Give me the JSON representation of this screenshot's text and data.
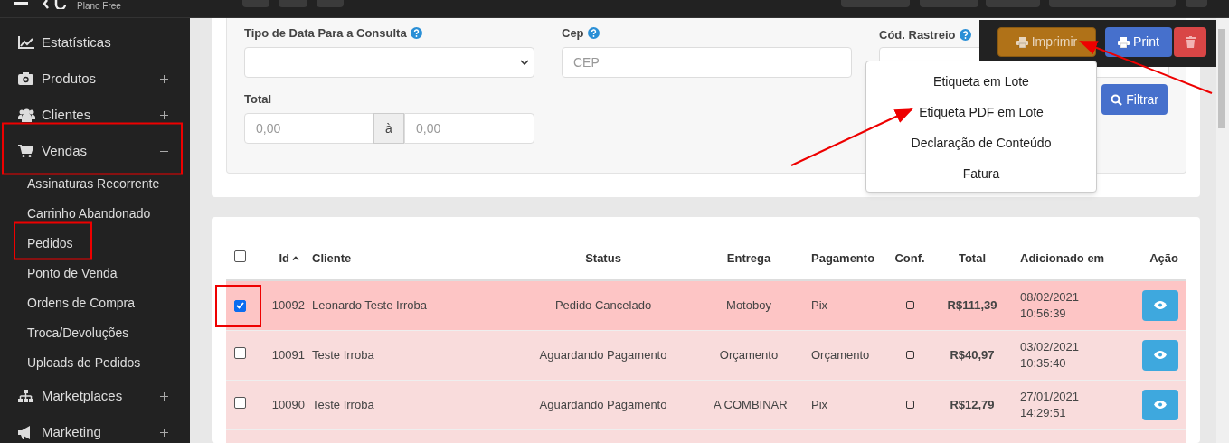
{
  "header": {
    "plan": "Plano Free"
  },
  "sidebar": {
    "items": [
      {
        "label": "Estatísticas",
        "kind": "link"
      },
      {
        "label": "Produtos",
        "kind": "group",
        "expanded": false
      },
      {
        "label": "Clientes",
        "kind": "group",
        "expanded": false
      },
      {
        "label": "Vendas",
        "kind": "group",
        "expanded": true,
        "children": [
          {
            "label": "Assinaturas Recorrente"
          },
          {
            "label": "Carrinho Abandonado"
          },
          {
            "label": "Pedidos"
          },
          {
            "label": "Ponto de Venda"
          },
          {
            "label": "Ordens de Compra"
          },
          {
            "label": "Troca/Devoluções"
          },
          {
            "label": "Uploads de Pedidos"
          }
        ]
      },
      {
        "label": "Marketplaces",
        "kind": "group",
        "expanded": false
      },
      {
        "label": "Marketing",
        "kind": "group",
        "expanded": false
      }
    ]
  },
  "filters": {
    "date_type": {
      "label": "Tipo de Data Para a Consulta"
    },
    "cep": {
      "label": "Cep",
      "placeholder": "CEP"
    },
    "tracking": {
      "label": "Cód. Rastreio"
    },
    "total": {
      "label": "Total",
      "from_placeholder": "0,00",
      "separator": "à",
      "to_placeholder": "0,00"
    },
    "filter_button": "Filtrar"
  },
  "actions": {
    "print_menu": "Imprimir",
    "print": "Print",
    "menu_items": [
      "Etiqueta em Lote",
      "Etiqueta PDF em Lote",
      "Declaração de Conteúdo",
      "Fatura"
    ]
  },
  "table": {
    "select_all": false,
    "columns": [
      "Id",
      "Cliente",
      "Status",
      "Entrega",
      "Pagamento",
      "Conf.",
      "Total",
      "Adicionado em",
      "Ação"
    ],
    "rows": [
      {
        "selected": true,
        "id": "10092",
        "client": "Leonardo Teste Irroba",
        "status": "Pedido Cancelado",
        "delivery": "Motoboy",
        "payment": "Pix",
        "confirmed": false,
        "total": "R$111,39",
        "date": "08/02/2021",
        "time": "10:56:39"
      },
      {
        "selected": false,
        "id": "10091",
        "client": "Teste Irroba",
        "status": "Aguardando Pagamento",
        "delivery": "Orçamento",
        "payment": "Orçamento",
        "confirmed": false,
        "total": "R$40,97",
        "date": "03/02/2021",
        "time": "10:35:40"
      },
      {
        "selected": false,
        "id": "10090",
        "client": "Teste Irroba",
        "status": "Aguardando Pagamento",
        "delivery": "A COMBINAR",
        "payment": "Pix",
        "confirmed": false,
        "total": "R$12,79",
        "date": "27/01/2021",
        "time": "14:29:51"
      }
    ]
  }
}
